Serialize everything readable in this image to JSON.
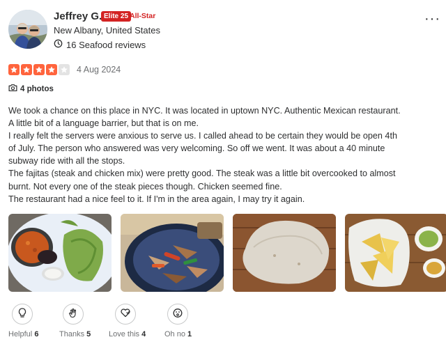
{
  "user": {
    "name": "Jeffrey G.",
    "elite_badge": "Elite 25",
    "allstar": "All-Star",
    "location": "New Albany, United States",
    "review_count_text": "16 Seafood reviews"
  },
  "review": {
    "rating": 4,
    "max_rating": 5,
    "date": "4 Aug 2024",
    "photos_label": "4 photos",
    "lines": [
      "We took a chance on this place in NYC. It was located in uptown NYC. Authentic Mexican restaurant.",
      "A little bit of a language barrier, but that is on me.",
      "I really felt the servers were anxious to serve us. I called ahead to be certain they would be open 4th",
      "of July. The person who answered was very welcoming. So off we went. It was about a 40 minute",
      "subway ride with all the stops.",
      "The fajitas (steak and chicken mix) were pretty good. The steak was a little bit overcooked to almost",
      "burnt. Not every one of the steak pieces though. Chicken seemed fine.",
      "The restaurant had a nice feel to it. If I'm in the area again, I may try it again."
    ]
  },
  "reactions": [
    {
      "label": "Helpful",
      "count": "6",
      "icon": "lightbulb-icon"
    },
    {
      "label": "Thanks",
      "count": "5",
      "icon": "clapping-hands-icon"
    },
    {
      "label": "Love this",
      "count": "4",
      "icon": "heart-icon"
    },
    {
      "label": "Oh no",
      "count": "1",
      "icon": "surprised-face-icon"
    }
  ],
  "colors": {
    "star_active": "#ff643d",
    "star_inactive": "#e3e3e3",
    "elite_red": "#d32323",
    "text_primary": "#2d2e2f",
    "text_secondary": "#6e7072"
  }
}
